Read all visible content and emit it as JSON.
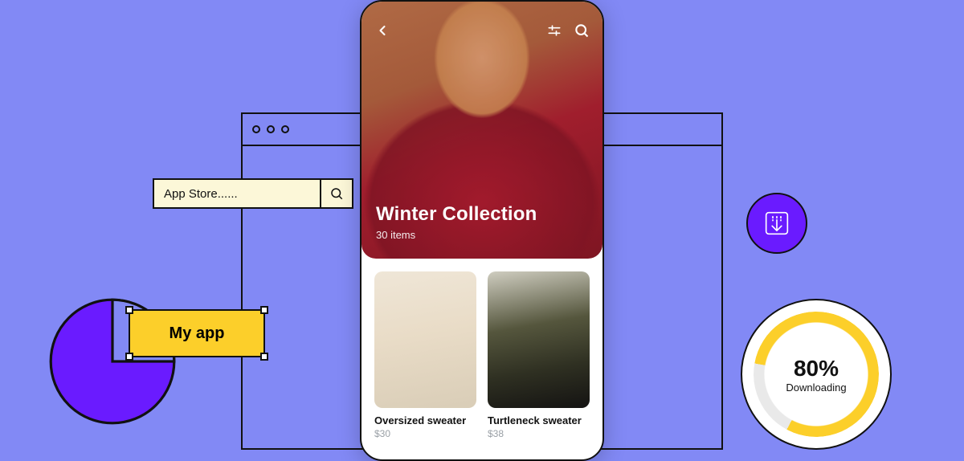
{
  "search": {
    "text": "App Store......"
  },
  "badge": {
    "label": "My app"
  },
  "phone": {
    "hero": {
      "title": "Winter Collection",
      "subtitle": "30 items"
    },
    "products": [
      {
        "name": "Oversized sweater",
        "price": "$30"
      },
      {
        "name": "Turtleneck sweater",
        "price": "$38"
      }
    ]
  },
  "progress": {
    "percent": "80%",
    "label": "Downloading"
  }
}
